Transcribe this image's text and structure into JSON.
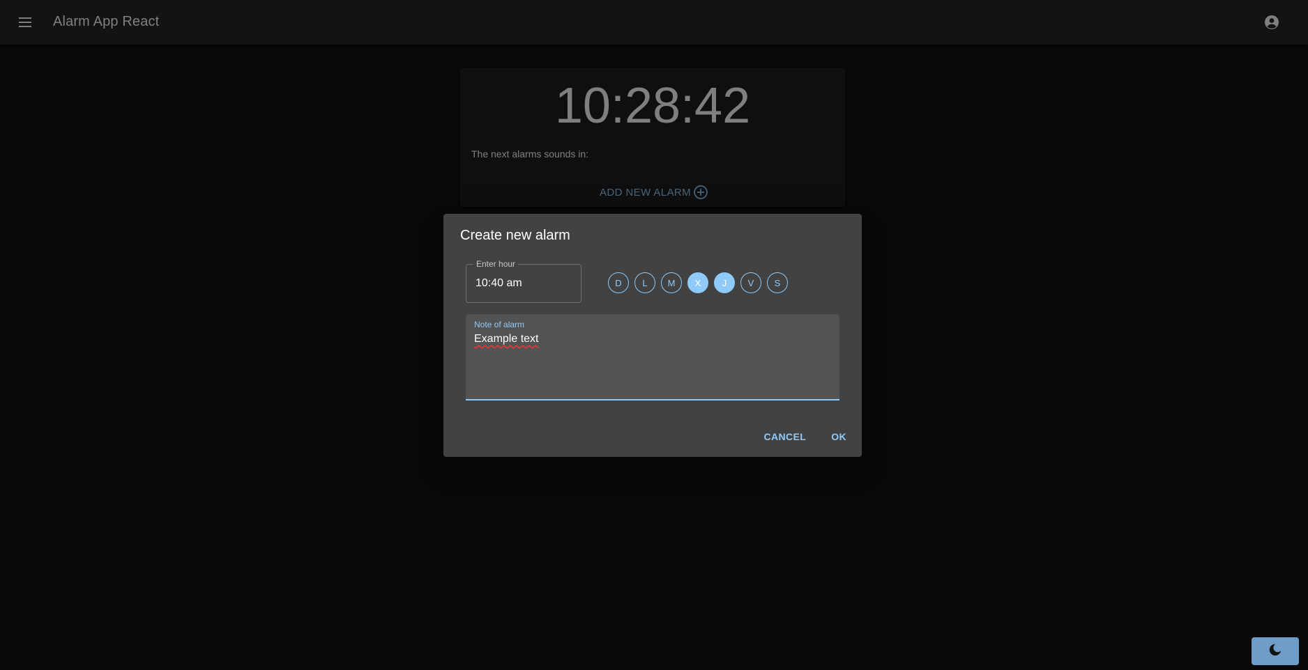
{
  "appbar": {
    "title": "Alarm App React",
    "menu_icon": "menu-icon",
    "account_icon": "account-circle-icon"
  },
  "clock": {
    "time": "10:28:42",
    "next_alarms_text": "The next alarms sounds in:",
    "add_alarm_label": "ADD NEW ALARM",
    "add_icon": "add-circle-icon"
  },
  "dialog": {
    "title": "Create new alarm",
    "hour_label": "Enter hour",
    "hour_value": "10:40 am",
    "days": [
      {
        "label": "D",
        "selected": false
      },
      {
        "label": "L",
        "selected": false
      },
      {
        "label": "M",
        "selected": false
      },
      {
        "label": "X",
        "selected": true
      },
      {
        "label": "J",
        "selected": true
      },
      {
        "label": "V",
        "selected": false
      },
      {
        "label": "S",
        "selected": false
      }
    ],
    "note_label": "Note of alarm",
    "note_value": "Example text",
    "cancel_label": "CANCEL",
    "ok_label": "OK"
  },
  "theme_toggle": {
    "icon": "moon-icon"
  },
  "colors": {
    "accent": "#90caf9",
    "background": "#121212",
    "appbar": "#272727",
    "dialog": "#424242"
  }
}
